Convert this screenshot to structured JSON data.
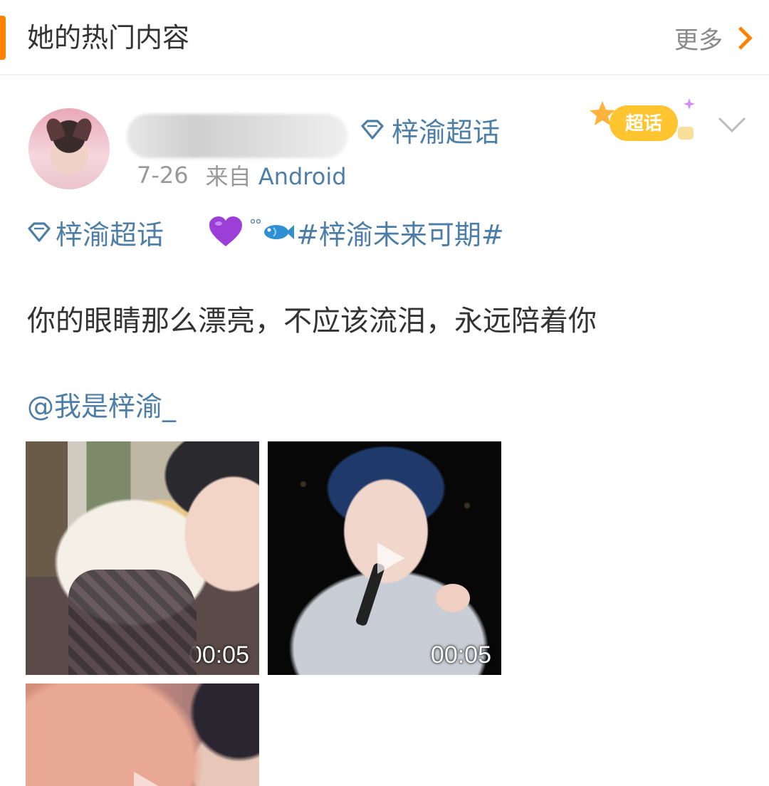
{
  "header": {
    "title": "她的热门内容",
    "more_label": "更多"
  },
  "post": {
    "topic_tag": "梓渝超话",
    "date": "7-26",
    "source_prefix": "来自",
    "source": "Android",
    "badge_label": "超话",
    "inline_tag": "梓渝超话",
    "bubbles": "°°",
    "hashtag": "#梓渝未来可期#",
    "text": "你的眼睛那么漂亮，不应该流泪，永远陪着你",
    "mention": "@我是梓渝_"
  },
  "media": [
    {
      "type": "video",
      "duration": "00:05"
    },
    {
      "type": "video",
      "duration": "00:05"
    },
    {
      "type": "video",
      "duration": ""
    }
  ],
  "colors": {
    "accent": "#ff8200",
    "link": "#4d7ea8",
    "text": "#333333",
    "meta": "#999999"
  },
  "icons": [
    "chevron-right-icon",
    "diamond-icon",
    "chaohua-badge-icon",
    "chevron-down-icon",
    "purple-heart-icon",
    "fish-icon",
    "play-icon"
  ]
}
